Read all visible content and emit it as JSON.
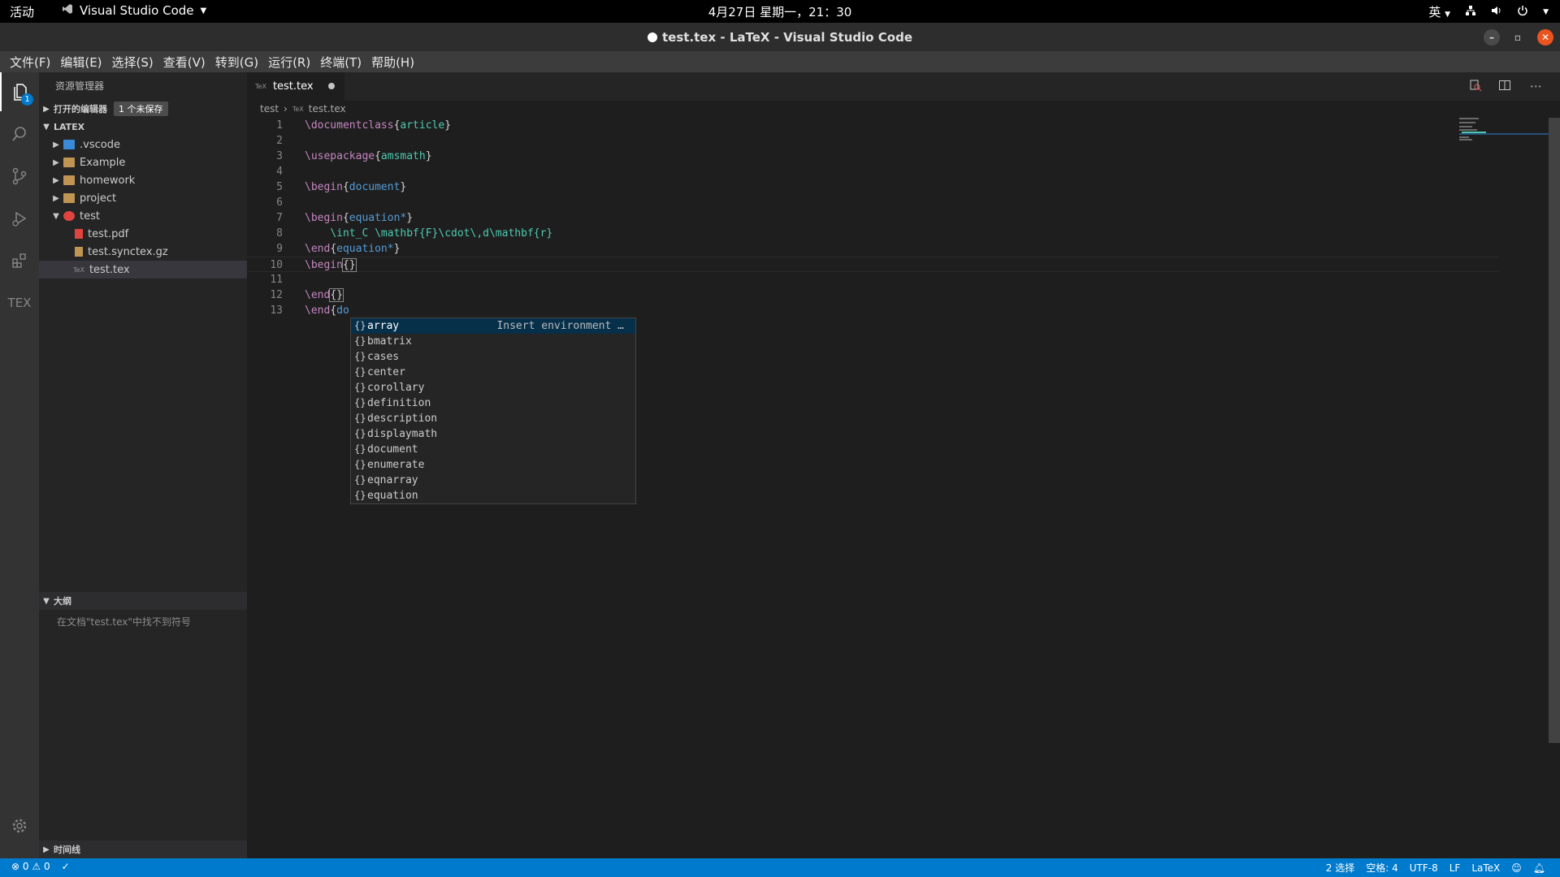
{
  "os_bar": {
    "activities": "活动",
    "app_name": "Visual Studio Code",
    "datetime": "4月27日 星期一，21：30",
    "input_method": "英"
  },
  "window": {
    "title": "test.tex - LaTeX - Visual Studio Code"
  },
  "menu": [
    "文件(F)",
    "编辑(E)",
    "选择(S)",
    "查看(V)",
    "转到(G)",
    "运行(R)",
    "终端(T)",
    "帮助(H)"
  ],
  "activity_bar": {
    "explorer_badge": "1",
    "icons": [
      "files-icon",
      "search-icon",
      "source-control-icon",
      "run-debug-icon",
      "extensions-icon",
      "tex-icon",
      "gear-icon"
    ],
    "tex_label": "TEX"
  },
  "sidebar": {
    "title": "资源管理器",
    "open_editors": {
      "label": "打开的编辑器",
      "badge": "1 个未保存"
    },
    "workspace": "LATEX",
    "tree": [
      {
        "label": ".vscode",
        "type": "folder",
        "expanded": false
      },
      {
        "label": "Example",
        "type": "folder",
        "expanded": false
      },
      {
        "label": "homework",
        "type": "folder",
        "expanded": false
      },
      {
        "label": "project",
        "type": "folder",
        "expanded": false
      },
      {
        "label": "test",
        "type": "folder",
        "expanded": true
      },
      {
        "label": "test.pdf",
        "type": "file"
      },
      {
        "label": "test.synctex.gz",
        "type": "file"
      },
      {
        "label": "test.tex",
        "type": "file",
        "selected": true
      }
    ],
    "outline": {
      "label": "大纲",
      "empty": "在文档\"test.tex\"中找不到符号"
    },
    "timeline": {
      "label": "时间线"
    }
  },
  "editor": {
    "tab": {
      "label": "test.tex",
      "dirty": true,
      "file_icon_text": "TeX"
    },
    "breadcrumb": [
      "test",
      "test.tex"
    ],
    "lines": [
      {
        "n": "1"
      },
      {
        "n": "2"
      },
      {
        "n": "3"
      },
      {
        "n": "4"
      },
      {
        "n": "5"
      },
      {
        "n": "6"
      },
      {
        "n": "7"
      },
      {
        "n": "8"
      },
      {
        "n": "9"
      },
      {
        "n": "10"
      },
      {
        "n": "11"
      },
      {
        "n": "12"
      },
      {
        "n": "13"
      }
    ],
    "code": {
      "l1_cmd": "\\documentclass",
      "l1_arg": "article",
      "l3_cmd": "\\usepackage",
      "l3_arg": "amsmath",
      "l5_cmd": "\\begin",
      "l5_arg": "document",
      "l7_cmd": "\\begin",
      "l7_arg": "equation*",
      "l8_text": "\\int_C \\mathbf{F}\\cdot\\,d\\mathbf{r}",
      "l9_cmd": "\\end",
      "l9_arg": "equation*",
      "l10_cmd": "\\begin",
      "l12_cmd": "\\end",
      "l13_cmd": "\\end",
      "l13_arg": "do"
    },
    "suggest": {
      "detail": "Insert environment …",
      "items": [
        "array",
        "bmatrix",
        "cases",
        "center",
        "corollary",
        "definition",
        "description",
        "displaymath",
        "document",
        "enumerate",
        "eqnarray",
        "equation"
      ]
    }
  },
  "status": {
    "errors": "0",
    "warnings": "0",
    "selections": "2 选择",
    "spaces": "空格: 4",
    "encoding": "UTF-8",
    "eol": "LF",
    "language": "LaTeX"
  }
}
